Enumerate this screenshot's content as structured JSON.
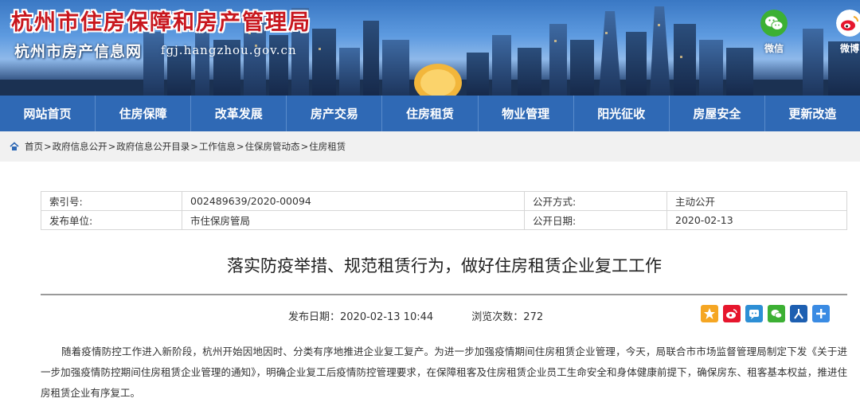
{
  "header": {
    "site_title": "杭州市住房保障和房产管理局",
    "site_subtitle": "杭州市房产信息网",
    "site_url": "fgj.hangzhou.gov.cn",
    "social": [
      {
        "label": "微信",
        "icon": "wechat-icon",
        "color": "#3cb034"
      },
      {
        "label": "微博",
        "icon": "weibo-icon",
        "color": "#e6162d"
      }
    ]
  },
  "nav": {
    "items": [
      "网站首页",
      "住房保障",
      "改革发展",
      "房产交易",
      "住房租赁",
      "物业管理",
      "阳光征收",
      "房屋安全",
      "更新改造"
    ]
  },
  "breadcrumb": {
    "home_icon": "home-icon",
    "items": [
      "首页",
      "政府信息公开",
      "政府信息公开目录",
      "工作信息",
      "住保房管动态",
      "住房租赁"
    ],
    "separator": ">"
  },
  "meta": {
    "index_label": "索引号:",
    "index_value": "002489639/2020-00094",
    "disclosure_label": "公开方式:",
    "disclosure_value": "主动公开",
    "unit_label": "发布单位:",
    "unit_value": "市住保房管局",
    "date_label": "公开日期:",
    "date_value": "2020-02-13"
  },
  "article": {
    "title": "落实防疫举措、规范租赁行为，做好住房租赁企业复工工作",
    "publish": "发布日期：2020-02-13 10:44",
    "views": "浏览次数：272",
    "share_icons": [
      {
        "name": "qzone-share-icon",
        "color": "#f5a623"
      },
      {
        "name": "weibo-share-icon",
        "color": "#e6162d"
      },
      {
        "name": "tencent-weibo-share-icon",
        "color": "#2d8fd5"
      },
      {
        "name": "wechat-share-icon",
        "color": "#3cb034"
      },
      {
        "name": "renren-share-icon",
        "color": "#1d5fb1"
      },
      {
        "name": "more-share-icon",
        "color": "#3a8be3"
      }
    ],
    "body": "随着疫情防控工作进入新阶段，杭州开始因地因时、分类有序地推进企业复工复产。为进一步加强疫情期间住房租赁企业管理，今天，局联合市市场监督管理局制定下发《关于进一步加强疫情防控期间住房租赁企业管理的通知》，明确企业复工后疫情防控管理要求，在保障租客及住房租赁企业员工生命安全和身体健康前提下，确保房东、租客基本权益，推进住房租赁企业有序复工。"
  }
}
